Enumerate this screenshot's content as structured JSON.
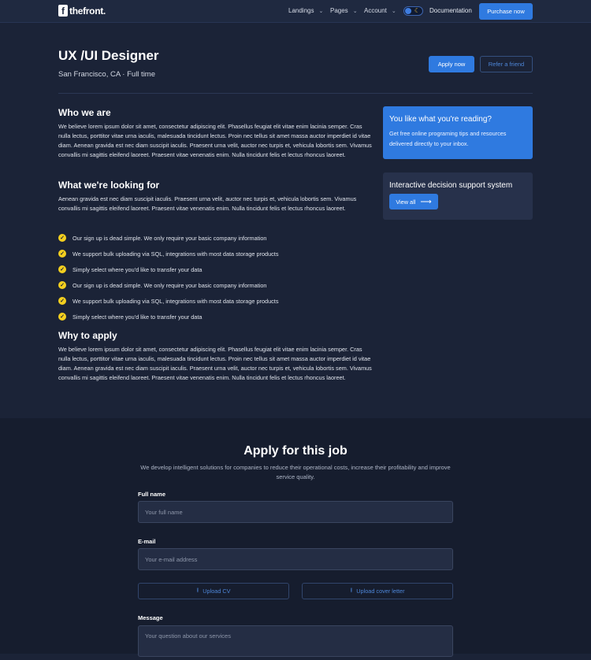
{
  "header": {
    "logo_letter": "f",
    "logo_text": "thefront.",
    "nav": [
      {
        "label": "Landings",
        "icon": "chevron-down-icon"
      },
      {
        "label": "Pages",
        "icon": "chevron-down-icon"
      },
      {
        "label": "Account",
        "icon": "chevron-down-icon"
      }
    ],
    "theme_toggle_icon": "moon-icon",
    "documentation": "Documentation",
    "purchase": "Purchase now"
  },
  "hero": {
    "title": "UX /UI Designer",
    "meta": "San Francisco, CA · Full time",
    "apply_now": "Apply now",
    "refer": "Refer a friend"
  },
  "content": {
    "who_title": "Who we are",
    "who_text": "We believe lorem ipsum dolor sit amet, consectetur adipiscing elit. Phasellus feugiat elit vitae enim lacinia semper. Cras nulla lectus, porttitor vitae urna iaculis, malesuada tincidunt lectus. Proin nec tellus sit amet massa auctor imperdiet id vitae diam. Aenean gravida est nec diam suscipit iaculis. Praesent urna velit, auctor nec turpis et, vehicula lobortis sem. Vivamus convallis mi sagittis eleifend laoreet. Praesent vitae venenatis enim. Nulla tincidunt felis et lectus rhoncus laoreet.",
    "looking_title": "What we're looking for",
    "looking_text": "Aenean gravida est nec diam suscipit iaculis. Praesent urna velit, auctor nec turpis et, vehicula lobortis sem. Vivamus convallis mi sagittis eleifend laoreet. Praesent vitae venenatis enim. Nulla tincidunt felis et lectus rhoncus laoreet.",
    "list": [
      "Our sign up is dead simple. We only require your basic company information",
      "We support bulk uploading via SQL, integrations with most data storage products",
      "Simply select where you'd like to transfer your data",
      "Our sign up is dead simple. We only require your basic company information",
      "We support bulk uploading via SQL, integrations with most data storage products",
      "Simply select where you'd like to transfer your data"
    ],
    "why_title": "Why to apply",
    "why_text": "We believe lorem ipsum dolor sit amet, consectetur adipiscing elit. Phasellus feugiat elit vitae enim lacinia semper. Cras nulla lectus, porttitor vitae urna iaculis, malesuada tincidunt lectus. Proin nec tellus sit amet massa auctor imperdiet id vitae diam. Aenean gravida est nec diam suscipit iaculis. Praesent urna velit, auctor nec turpis et, vehicula lobortis sem. Vivamus convallis mi sagittis eleifend laoreet. Praesent vitae venenatis enim. Nulla tincidunt felis et lectus rhoncus laoreet."
  },
  "sidebar": {
    "card1_title": "You like what you're reading?",
    "card1_text": "Get free online programing tips and resources delivered directly to your inbox.",
    "card2_title": "Interactive decision support system",
    "view_all": "View all",
    "arrow_icon": "arrow-right-icon"
  },
  "apply": {
    "title": "Apply for this job",
    "subtitle": "We develop intelligent solutions for companies to reduce their operational costs, increase their profitability and improve service quality.",
    "fullname_label": "Full name",
    "fullname_placeholder": "Your full name",
    "email_label": "E-mail",
    "email_placeholder": "Your e-mail address",
    "upload_cv": "Upload CV",
    "upload_cover": "Upload cover letter",
    "upload_icon": "upload-arrow-icon",
    "message_label": "Message",
    "message_placeholder": "Your question about our services"
  },
  "colors": {
    "background": "#1b2337",
    "accent": "#2f7ae0",
    "check": "#f4cf1f"
  }
}
